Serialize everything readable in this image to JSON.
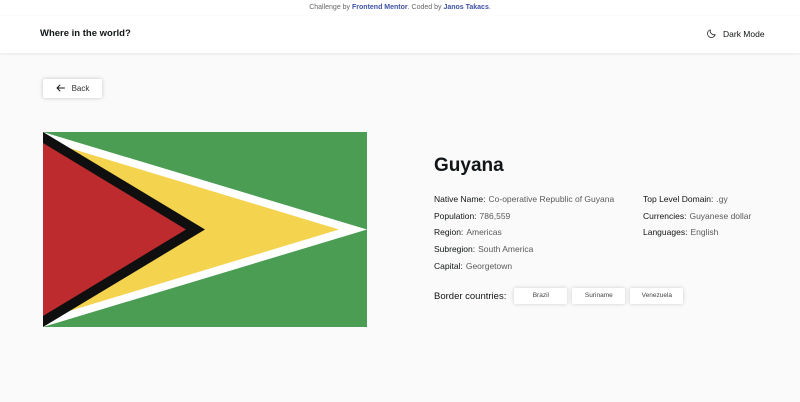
{
  "attribution": {
    "prefix": "Challenge by",
    "challenge_author": "Frontend Mentor",
    "coded_by": ". Coded by",
    "coder": "Janos Takacs",
    "suffix": "."
  },
  "header": {
    "title": "Where in the world?",
    "theme_toggle_label": "Dark Mode"
  },
  "back_button": {
    "label": "Back"
  },
  "country": {
    "name": "Guyana",
    "details_left": [
      {
        "label": "Native Name:",
        "value": "Co-operative Republic of Guyana"
      },
      {
        "label": "Population:",
        "value": "786,559"
      },
      {
        "label": "Region:",
        "value": "Americas"
      },
      {
        "label": "Subregion:",
        "value": "South America"
      },
      {
        "label": "Capital:",
        "value": "Georgetown"
      }
    ],
    "details_right": [
      {
        "label": "Top Level Domain:",
        "value": ".gy"
      },
      {
        "label": "Currencies:",
        "value": "Guyanese dollar"
      },
      {
        "label": "Languages:",
        "value": "English"
      }
    ],
    "border_label": "Border countries:",
    "borders": [
      "Brazil",
      "Suriname",
      "Venezuela"
    ]
  },
  "flag_colors": {
    "green": "#4a9d53",
    "white": "#ffffff",
    "yellow": "#f4d34f",
    "black": "#0f0f0f",
    "red": "#bd2b2f"
  },
  "icons": {
    "theme": "moon-icon",
    "back": "arrow-left-icon"
  }
}
